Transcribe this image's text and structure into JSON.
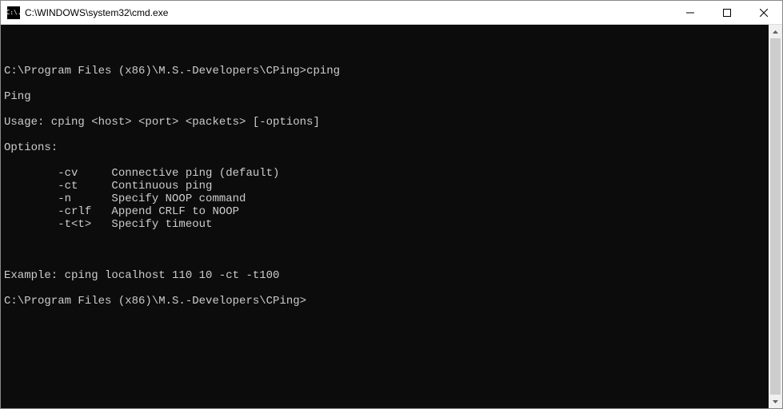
{
  "window": {
    "title": "C:\\WINDOWS\\system32\\cmd.exe",
    "icon_text": "C:\\."
  },
  "terminal": {
    "prompt1": "C:\\Program Files (x86)\\M.S.-Developers\\CPing>",
    "command1": "cping",
    "line_ping": "Ping",
    "usage": "Usage: cping <host> <port> <packets> [-options]",
    "options_header": "Options:",
    "options": [
      {
        "flag": "-cv",
        "desc": "Connective ping (default)"
      },
      {
        "flag": "-ct",
        "desc": "Continuous ping"
      },
      {
        "flag": "-n",
        "desc": "Specify NOOP command"
      },
      {
        "flag": "-crlf",
        "desc": "Append CRLF to NOOP"
      },
      {
        "flag": "-t<t>",
        "desc": "Specify timeout"
      }
    ],
    "example": "Example: cping localhost 110 10 -ct -t100",
    "prompt2": "C:\\Program Files (x86)\\M.S.-Developers\\CPing>"
  }
}
